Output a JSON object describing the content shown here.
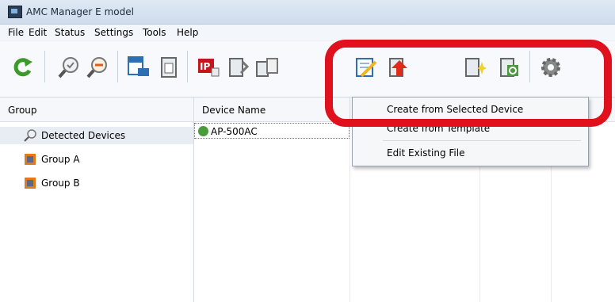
{
  "window": {
    "title": "AMC Manager E model"
  },
  "menu": [
    {
      "label": "File"
    },
    {
      "label": "Edit"
    },
    {
      "label": "Status"
    },
    {
      "label": "Settings"
    },
    {
      "label": "Tools"
    },
    {
      "label": "Help"
    }
  ],
  "toolbar": {
    "buttons": [
      {
        "icon": "refresh-icon"
      },
      {
        "icon": "search-icon"
      },
      {
        "icon": "search-minus-icon"
      },
      {
        "icon": "web-icon"
      },
      {
        "icon": "file-icon"
      },
      {
        "icon": "ip-icon"
      },
      {
        "icon": "wrench-icon"
      },
      {
        "icon": "device-wrench-icon"
      },
      {
        "icon": "edit-icon"
      },
      {
        "icon": "upload-icon"
      },
      {
        "icon": "new-file-icon"
      },
      {
        "icon": "power-icon"
      },
      {
        "icon": "gear-icon"
      }
    ]
  },
  "group_panel": {
    "header": "Group",
    "items": [
      {
        "label": "Detected Devices",
        "icon": "search-icon"
      },
      {
        "label": "Group A",
        "icon": "group-icon"
      },
      {
        "label": "Group B",
        "icon": "group-icon"
      }
    ]
  },
  "device_panel": {
    "header": "Device Name",
    "rows": [
      {
        "name": "AP-500AC",
        "status_icon": "check-icon"
      }
    ]
  },
  "dropdown": {
    "items": [
      {
        "label": "Create from Selected Device"
      },
      {
        "label": "Create from Template"
      },
      {
        "label": "Edit Existing File"
      }
    ]
  },
  "colors": {
    "highlight": "#e0101c",
    "accent": "#4a9b3b"
  }
}
